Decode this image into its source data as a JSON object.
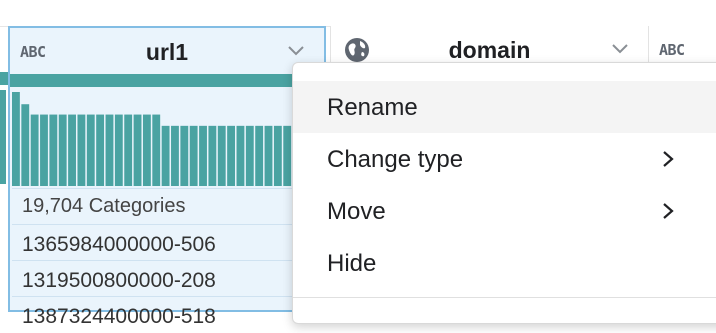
{
  "columns": [
    {
      "type_label": "ABC",
      "name": "url1",
      "quality_color": "#4aa3a2",
      "histogram_bar_values": [
        100,
        87,
        76,
        76,
        76,
        76,
        76,
        76,
        76,
        76,
        76,
        76,
        76,
        76,
        76,
        76,
        64,
        64,
        64,
        64,
        64,
        64,
        64,
        64,
        64,
        64,
        64,
        64,
        64,
        64,
        64
      ],
      "categories_text": "19,704 Categories",
      "rows": [
        "1365984000000-506",
        "1319500800000-208",
        "1387324400000-518"
      ]
    },
    {
      "type_icon": "globe-icon",
      "name": "domain"
    },
    {
      "type_label": "ABC"
    }
  ],
  "context_menu": {
    "items": [
      {
        "label": "Rename",
        "has_submenu": false,
        "highlighted": true
      },
      {
        "label": "Change type",
        "has_submenu": true,
        "highlighted": false
      },
      {
        "label": "Move",
        "has_submenu": true,
        "highlighted": false
      },
      {
        "label": "Hide",
        "has_submenu": false,
        "highlighted": false
      }
    ]
  }
}
